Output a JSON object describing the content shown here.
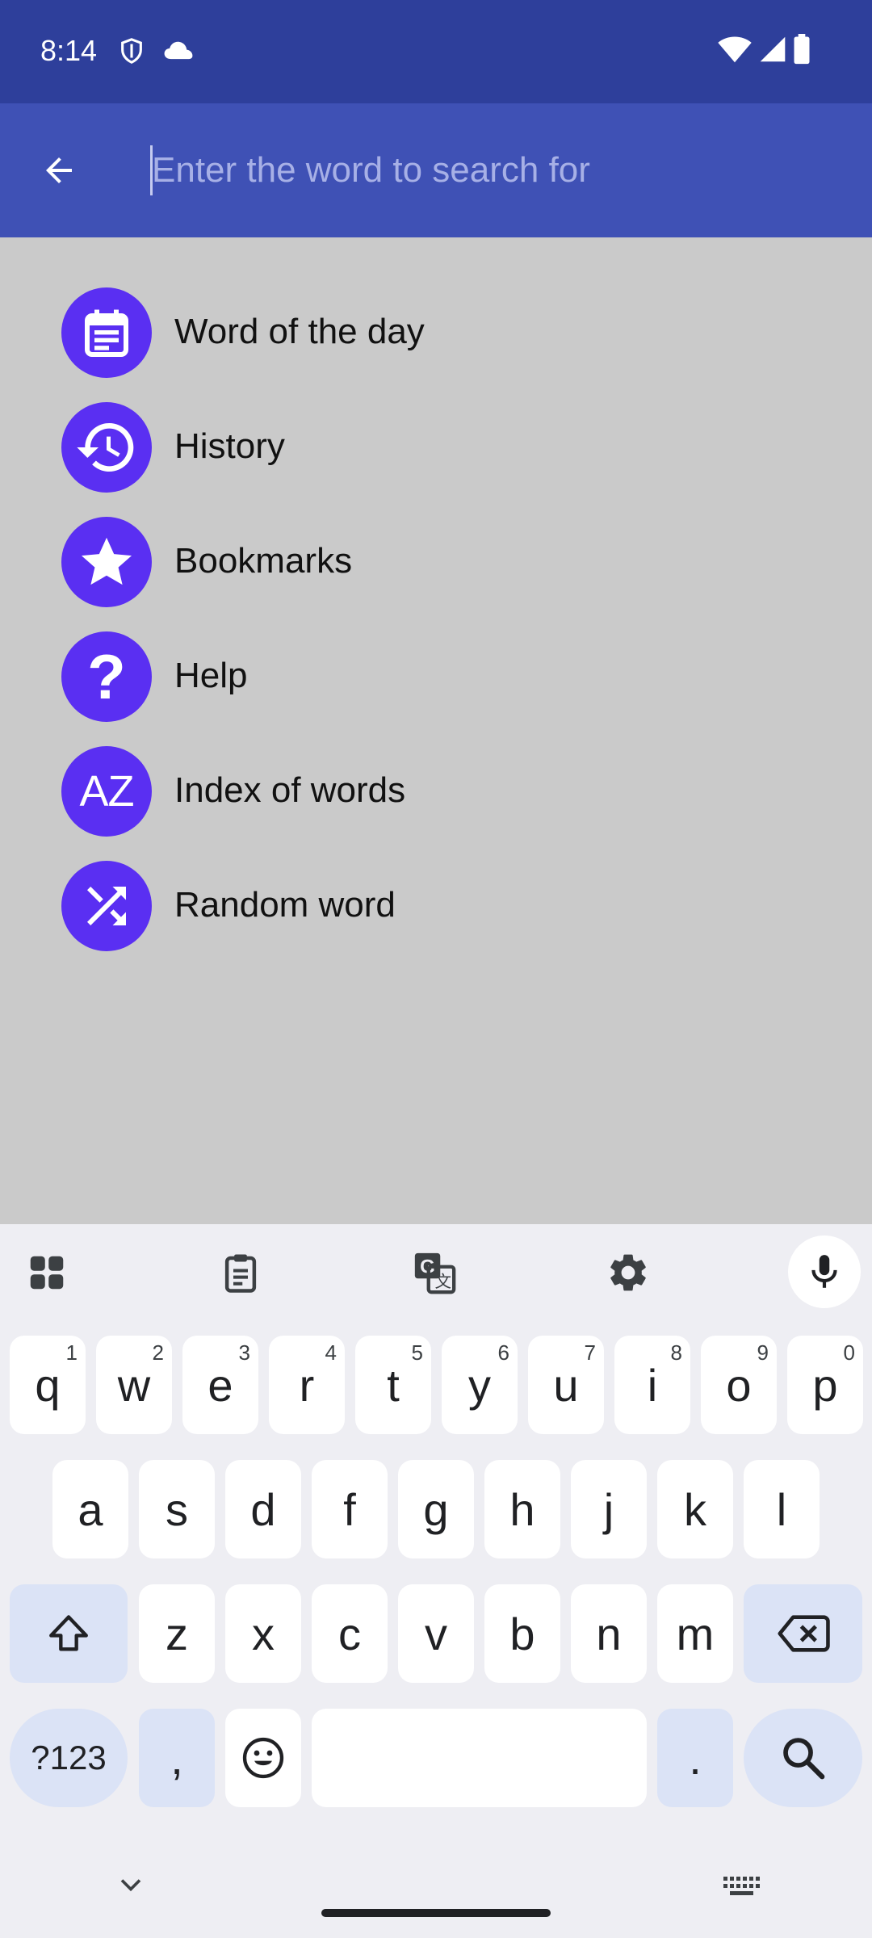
{
  "status_bar": {
    "time": "8:14",
    "left_icons": [
      "shield-icon",
      "cloud-icon"
    ],
    "right_icons": [
      "wifi-icon",
      "signal-icon",
      "battery-icon"
    ]
  },
  "app_bar": {
    "back_icon": "arrow-back-icon",
    "search_placeholder": "Enter the word to search for",
    "search_value": ""
  },
  "menu": {
    "items": [
      {
        "label": "Word of the day",
        "icon": "calendar-icon"
      },
      {
        "label": "History",
        "icon": "history-icon"
      },
      {
        "label": "Bookmarks",
        "icon": "star-icon"
      },
      {
        "label": "Help",
        "icon": "question-icon",
        "glyph": "?"
      },
      {
        "label": "Index of words",
        "icon": "az-icon",
        "glyph": "AZ"
      },
      {
        "label": "Random word",
        "icon": "shuffle-icon"
      }
    ]
  },
  "keyboard": {
    "toolbar": [
      "apps-grid-icon",
      "clipboard-icon",
      "translate-icon",
      "gear-icon",
      "mic-icon"
    ],
    "row1": [
      {
        "key": "q",
        "hint": "1"
      },
      {
        "key": "w",
        "hint": "2"
      },
      {
        "key": "e",
        "hint": "3"
      },
      {
        "key": "r",
        "hint": "4"
      },
      {
        "key": "t",
        "hint": "5"
      },
      {
        "key": "y",
        "hint": "6"
      },
      {
        "key": "u",
        "hint": "7"
      },
      {
        "key": "i",
        "hint": "8"
      },
      {
        "key": "o",
        "hint": "9"
      },
      {
        "key": "p",
        "hint": "0"
      }
    ],
    "row2": [
      "a",
      "s",
      "d",
      "f",
      "g",
      "h",
      "j",
      "k",
      "l"
    ],
    "row3": [
      "z",
      "x",
      "c",
      "v",
      "b",
      "n",
      "m"
    ],
    "symbols_label": "?123",
    "comma": ",",
    "period": ".",
    "shift_icon": "shift-icon",
    "backspace_icon": "backspace-icon",
    "emoji_icon": "emoji-icon",
    "search_icon": "search-icon"
  },
  "nav_bar": {
    "left_icon": "chevron-down-icon",
    "right_icon": "keyboard-icon"
  },
  "colors": {
    "status_bar": "#2e3f9b",
    "app_bar": "#3f51b5",
    "accent": "#5a2ff2",
    "list_bg": "#cacaca",
    "keyboard_bg": "#eeeef3",
    "modifier_key": "#dbe3f6"
  }
}
